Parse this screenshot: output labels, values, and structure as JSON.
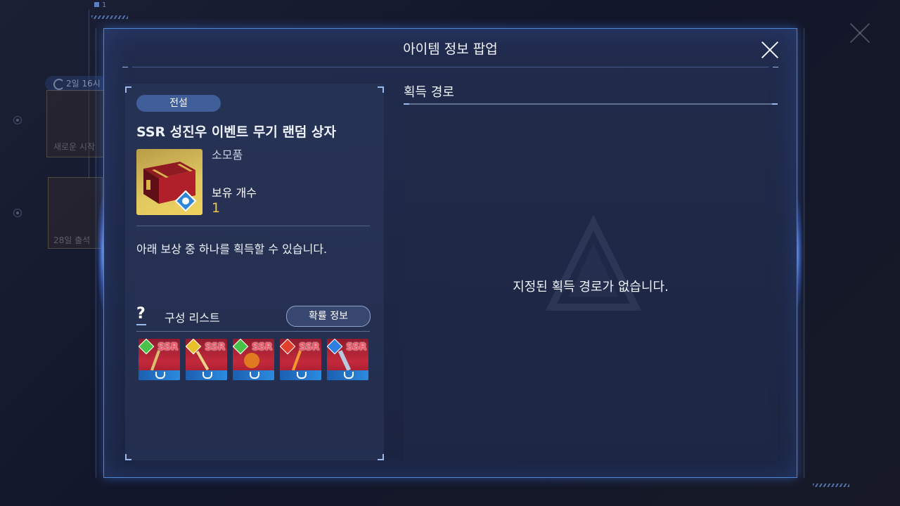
{
  "popup": {
    "title": "아이템 정보 팝업"
  },
  "item": {
    "grade": "전설",
    "name": "SSR 성진우 이벤트 무기 랜덤 상자",
    "category": "소모품",
    "owned_label": "보유 개수",
    "owned_count": "1",
    "description": "아래 보상 중 하나를 획득할 수 있습니다."
  },
  "composition": {
    "help_symbol": "?",
    "label": "구성 리스트",
    "probability_button": "확률 정보",
    "rewards": [
      {
        "rarity": "SSR",
        "element_color": "#49c24a"
      },
      {
        "rarity": "SSR",
        "element_color": "#e7c02c"
      },
      {
        "rarity": "SSR",
        "element_color": "#49c24a"
      },
      {
        "rarity": "SSR",
        "element_color": "#e0402c"
      },
      {
        "rarity": "SSR",
        "element_color": "#2f7fe0"
      }
    ]
  },
  "acquisition": {
    "heading": "획득 경로",
    "empty_message": "지정된 획득 경로가 없습니다."
  },
  "background": {
    "page_indicator": "1",
    "badge_text": "2일 16시",
    "card1_text": "새로운 시작",
    "card2_text": "28일 출석"
  },
  "colors": {
    "accent_border": "#4f86d6",
    "owned_count": "#f2c649",
    "grade_badge": "#3f5e9a"
  }
}
